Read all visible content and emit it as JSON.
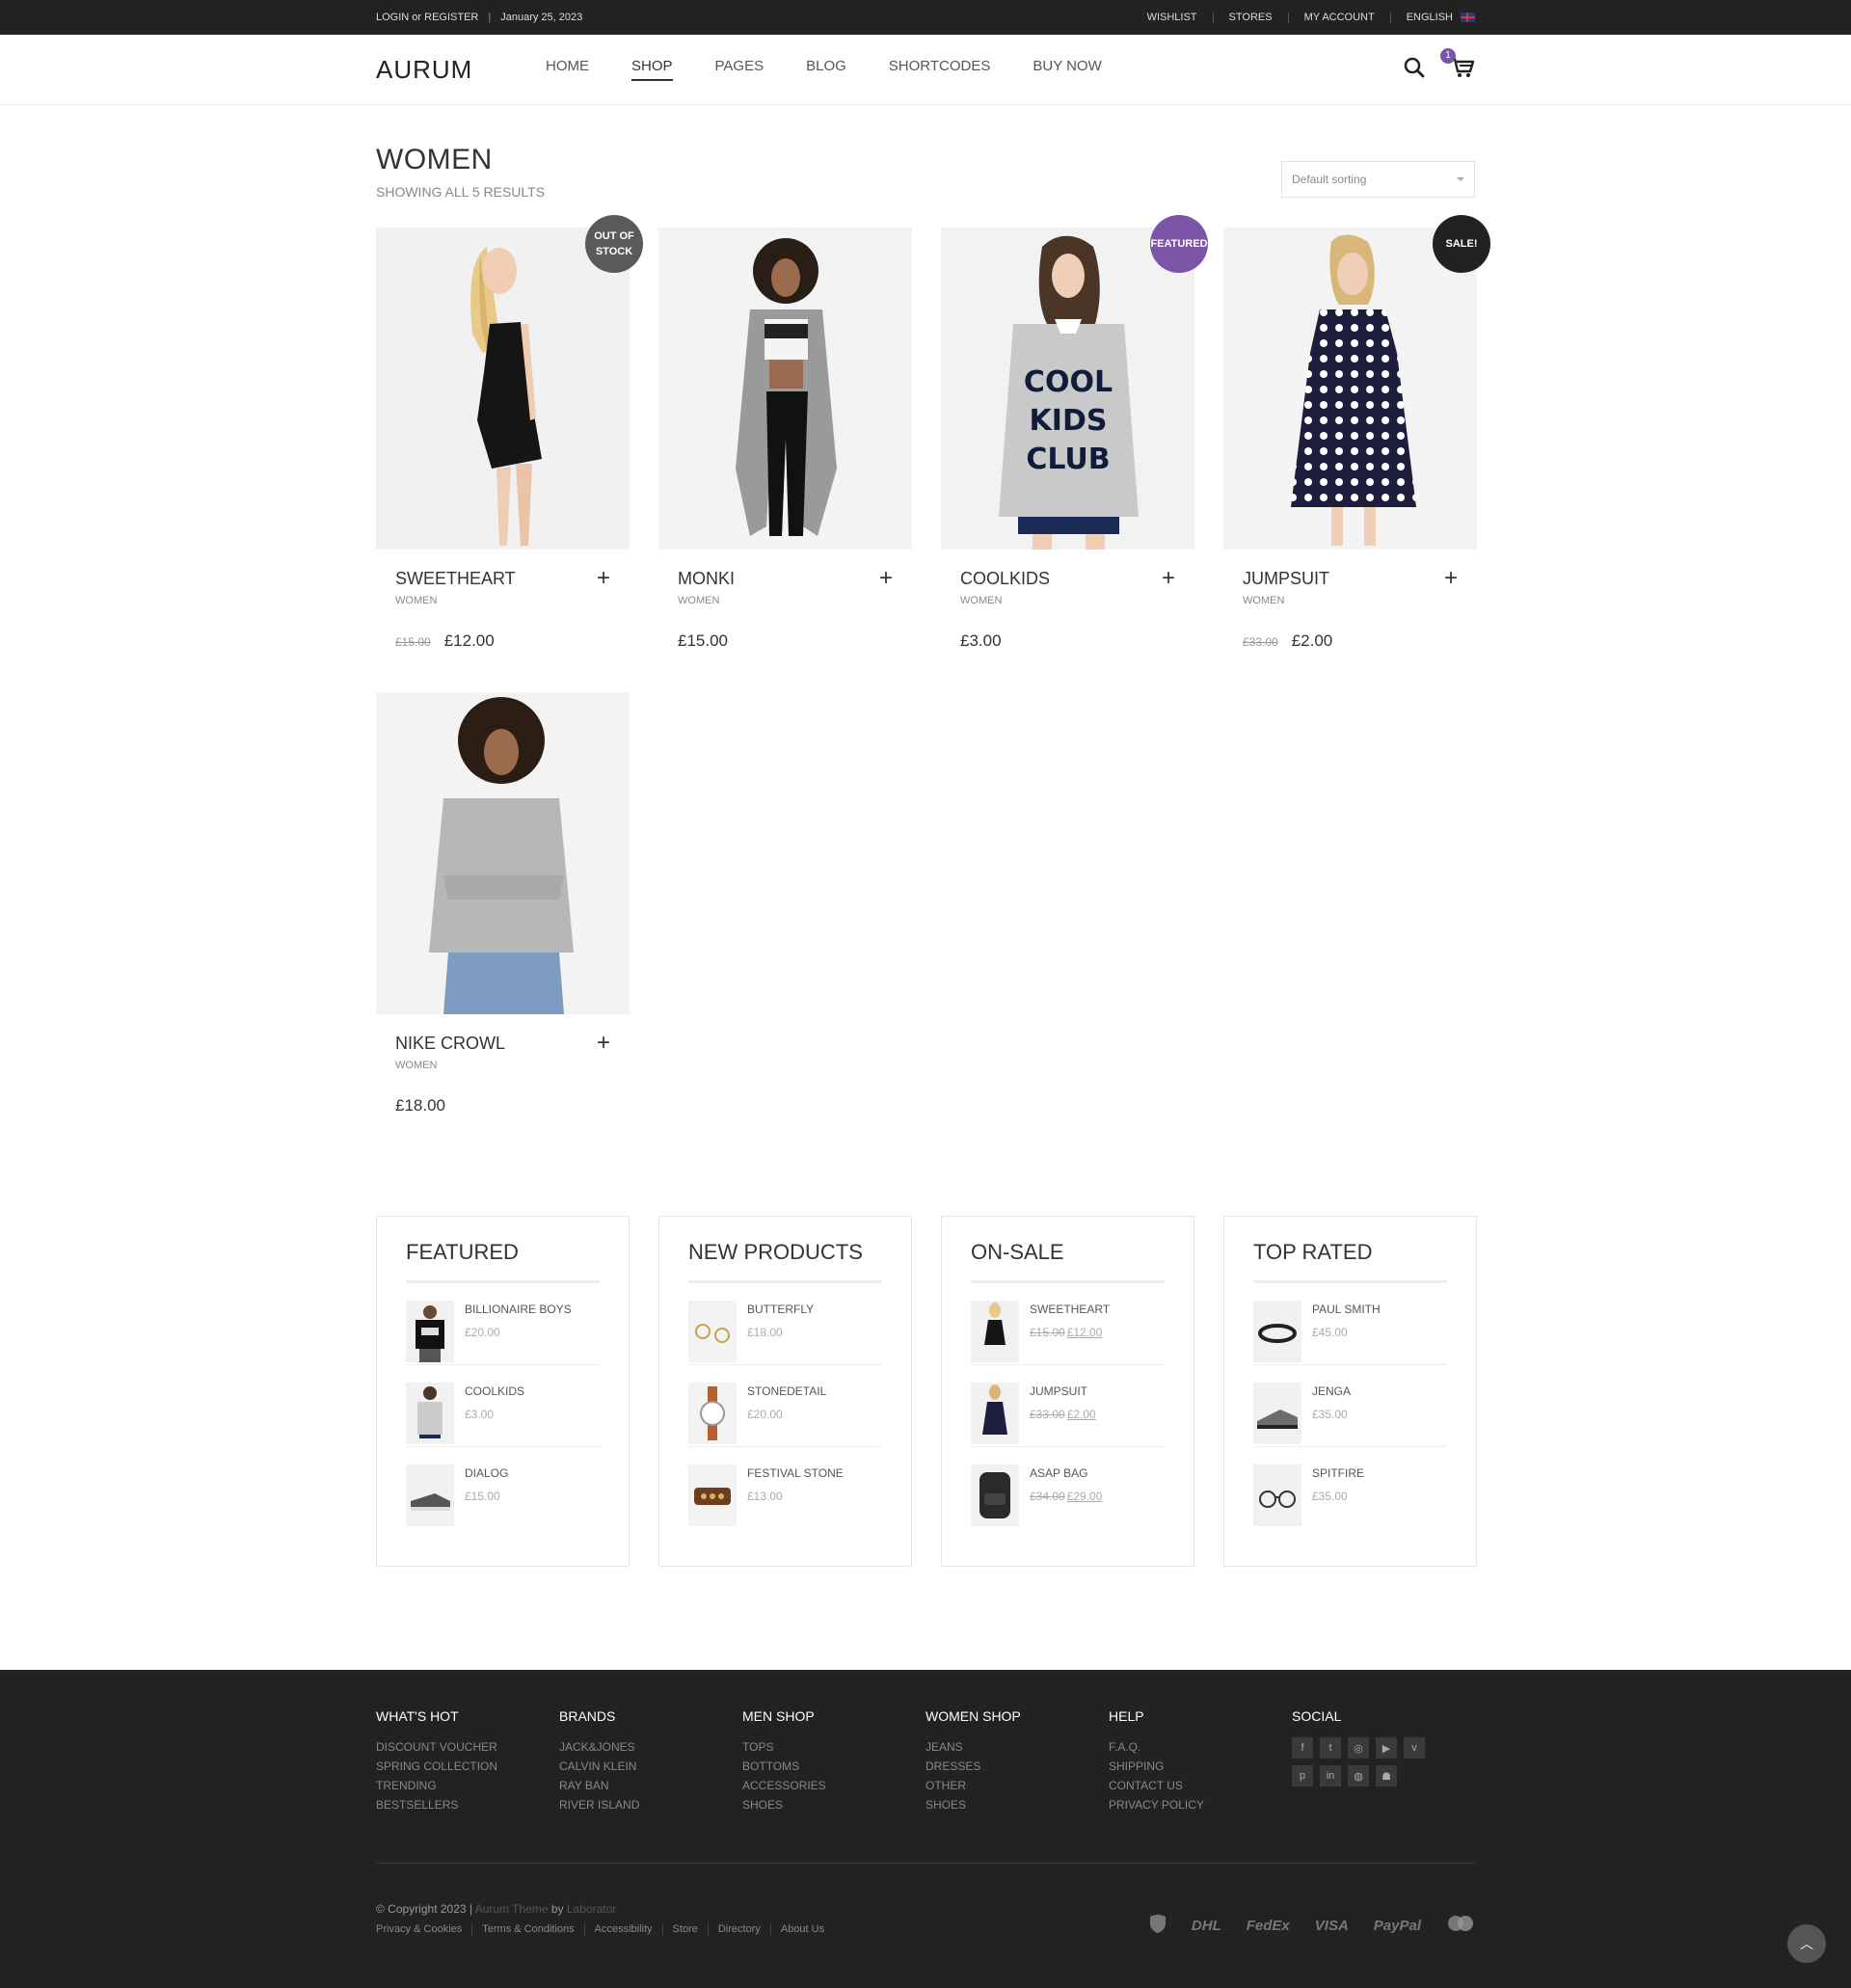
{
  "topbar": {
    "login": "LOGIN or REGISTER",
    "date": "January 25, 2023",
    "links": [
      "WISHLIST",
      "STORES",
      "MY ACCOUNT"
    ],
    "language": "ENGLISH"
  },
  "header": {
    "logo": "AURUM",
    "nav": [
      "HOME",
      "SHOP",
      "PAGES",
      "BLOG",
      "SHORTCODES",
      "BUY NOW"
    ],
    "active_nav": "SHOP",
    "cart_count": "1"
  },
  "page": {
    "title": "WOMEN",
    "results": "SHOWING ALL 5 RESULTS",
    "sorting": "Default sorting"
  },
  "products": [
    {
      "name": "SWEETHEART",
      "category": "WOMEN",
      "old_price": "£15.00",
      "price": "£12.00",
      "badge": "OUT OF STOCK",
      "badge_color": "#5a5a5a",
      "image": "woman-black-dress"
    },
    {
      "name": "MONKI",
      "category": "WOMEN",
      "old_price": "",
      "price": "£15.00",
      "badge": "",
      "badge_color": "",
      "image": "woman-grey-cardigan"
    },
    {
      "name": "COOLKIDS",
      "category": "WOMEN",
      "old_price": "",
      "price": "£3.00",
      "badge": "FEATURED",
      "badge_color": "#7b55a8",
      "image": "woman-grey-sweatshirt"
    },
    {
      "name": "JUMPSUIT",
      "category": "WOMEN",
      "old_price": "£33.00",
      "price": "£2.00",
      "badge": "SALE!",
      "badge_color": "#222222",
      "image": "woman-polka-dress"
    },
    {
      "name": "NIKE CROWL",
      "category": "WOMEN",
      "old_price": "",
      "price": "£18.00",
      "badge": "",
      "badge_color": "",
      "image": "woman-grey-hoodie"
    }
  ],
  "widgets": [
    {
      "title": "FEATURED",
      "items": [
        {
          "name": "BILLIONAIRE BOYS",
          "old_price": "",
          "price": "£20.00"
        },
        {
          "name": "COOLKIDS",
          "old_price": "",
          "price": "£3.00"
        },
        {
          "name": "DIALOG",
          "old_price": "",
          "price": "£15.00"
        }
      ]
    },
    {
      "title": "NEW PRODUCTS",
      "items": [
        {
          "name": "BUTTERFLY",
          "old_price": "",
          "price": "£18.00"
        },
        {
          "name": "STONEDETAIL",
          "old_price": "",
          "price": "£20.00"
        },
        {
          "name": "FESTIVAL STONE",
          "old_price": "",
          "price": "£13.00"
        }
      ]
    },
    {
      "title": "ON-SALE",
      "items": [
        {
          "name": "SWEETHEART",
          "old_price": "£15.00",
          "price": "£12.00"
        },
        {
          "name": "JUMPSUIT",
          "old_price": "£33.00",
          "price": "£2.00"
        },
        {
          "name": "ASAP BAG",
          "old_price": "£34.00",
          "price": "£29.00"
        }
      ]
    },
    {
      "title": "TOP RATED",
      "items": [
        {
          "name": "PAUL SMITH",
          "old_price": "",
          "price": "£45.00"
        },
        {
          "name": "JENGA",
          "old_price": "",
          "price": "£35.00"
        },
        {
          "name": "SPITFIRE",
          "old_price": "",
          "price": "£35.00"
        }
      ]
    }
  ],
  "footer": {
    "columns": [
      {
        "title": "WHAT'S HOT",
        "links": [
          "DISCOUNT VOUCHER",
          "SPRING COLLECTION",
          "TRENDING",
          "BESTSELLERS"
        ]
      },
      {
        "title": "BRANDS",
        "links": [
          "JACK&JONES",
          "CALVIN KLEIN",
          "RAY BAN",
          "RIVER ISLAND"
        ]
      },
      {
        "title": "MEN SHOP",
        "links": [
          "TOPS",
          "BOTTOMS",
          "ACCESSORIES",
          "SHOES"
        ]
      },
      {
        "title": "WOMEN SHOP",
        "links": [
          "JEANS",
          "DRESSES",
          "OTHER",
          "SHOES"
        ]
      },
      {
        "title": "HELP",
        "links": [
          "F.A.Q.",
          "SHIPPING",
          "CONTACT US",
          "PRIVACY POLICY"
        ]
      }
    ],
    "social_title": "SOCIAL",
    "social_icons": [
      "facebook-icon",
      "twitter-icon",
      "instagram-icon",
      "youtube-icon",
      "vimeo-icon",
      "pinterest-icon",
      "linkedin-icon",
      "dribbble-icon",
      "snapchat-icon"
    ],
    "copyright": "© Copyright 2023 |",
    "theme": "Aurum Theme",
    "by": "by",
    "author": "Laborator",
    "bottom_links": [
      "Privacy & Cookies",
      "Terms & Conditions",
      "Accessibility",
      "Store",
      "Directory",
      "About Us"
    ],
    "payments": [
      "DHL",
      "FedEx",
      "VISA",
      "PayPal"
    ]
  }
}
